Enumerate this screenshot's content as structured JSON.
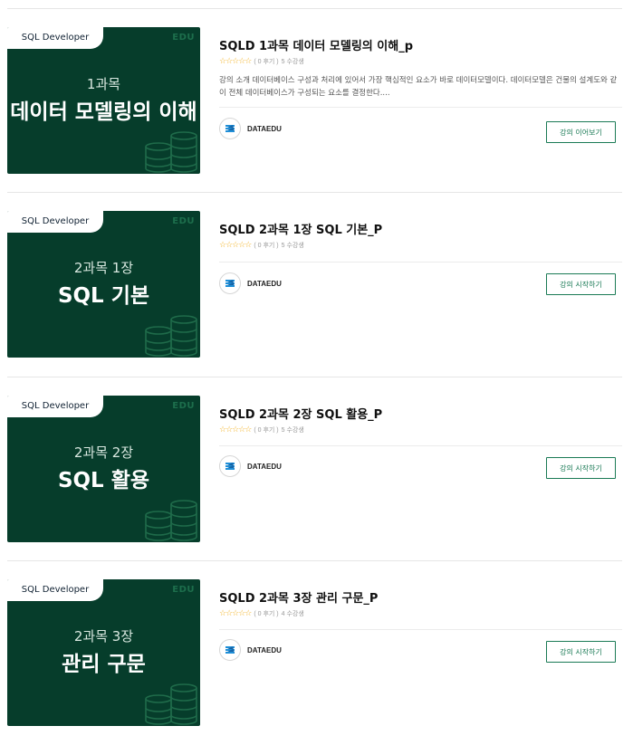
{
  "courses": [
    {
      "tag": "SQL Developer",
      "brand": "EDU",
      "thumb_sub": "1과목",
      "thumb_title": "데이터 모델링의 이해",
      "title": "SQLD 1과목 데이터 모델링의 이해_p",
      "stars": "☆☆☆☆☆",
      "reviews": "( 0 후기 )",
      "students": "5 수강생",
      "description": "강의 소개 데이터베이스 구성과 처리에 있어서 가장 핵심적인 요소가 바로 데이터모델이다. 데이터모델은 건물의 설계도와 같이 전체 데이터베이스가 구성되는 요소를 결정한다....",
      "author": "DATAEDU",
      "button": "강의 이어보기"
    },
    {
      "tag": "SQL Developer",
      "brand": "EDU",
      "thumb_sub": "2과목 1장",
      "thumb_title": "SQL 기본",
      "title": "SQLD 2과목 1장 SQL 기본_P",
      "stars": "☆☆☆☆☆",
      "reviews": "( 0 후기 )",
      "students": "5 수강생",
      "description": "",
      "author": "DATAEDU",
      "button": "강의 시작하기"
    },
    {
      "tag": "SQL Developer",
      "brand": "EDU",
      "thumb_sub": "2과목 2장",
      "thumb_title": "SQL 활용",
      "title": "SQLD 2과목 2장 SQL 활용_P",
      "stars": "☆☆☆☆☆",
      "reviews": "( 0 후기 )",
      "students": "5 수강생",
      "description": "",
      "author": "DATAEDU",
      "button": "강의 시작하기"
    },
    {
      "tag": "SQL Developer",
      "brand": "EDU",
      "thumb_sub": "2과목 3장",
      "thumb_title": "관리 구문",
      "title": "SQLD 2과목 3장 관리 구문_P",
      "stars": "☆☆☆☆☆",
      "reviews": "( 0 후기 )",
      "students": "4 수강생",
      "description": "",
      "author": "DATAEDU",
      "button": "강의 시작하기"
    }
  ],
  "colors": {
    "thumb_bg": "#063d2b",
    "accent": "#1a7a55",
    "star": "#f2b01e"
  }
}
